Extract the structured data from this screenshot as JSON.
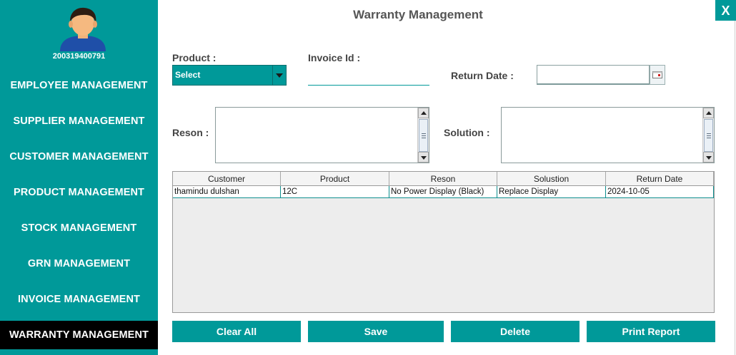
{
  "user": {
    "id": "200319400791"
  },
  "sidebar": {
    "items": [
      {
        "label": "EMPLOYEE MANAGEMENT"
      },
      {
        "label": "SUPPLIER MANAGEMENT"
      },
      {
        "label": "CUSTOMER MANAGEMENT"
      },
      {
        "label": "PRODUCT MANAGEMENT"
      },
      {
        "label": "STOCK MANAGEMENT"
      },
      {
        "label": "GRN MANAGEMENT"
      },
      {
        "label": "INVOICE MANAGEMENT"
      },
      {
        "label": "WARRANTY MANAGEMENT"
      }
    ],
    "active_index": 7
  },
  "header": {
    "title": "Warranty Management",
    "close_label": "X"
  },
  "form": {
    "product_label": "Product :",
    "product_value": "Select",
    "invoice_label": "Invoice Id :",
    "invoice_value": "",
    "return_date_label": "Return Date :",
    "return_date_value": "",
    "reason_label": "Reson :",
    "reason_value": "",
    "solution_label": "Solution :",
    "solution_value": ""
  },
  "table": {
    "columns": [
      "Customer",
      "Product",
      "Reson",
      "Solustion",
      "Return Date"
    ],
    "rows": [
      [
        "thamindu dulshan",
        "12C",
        "No Power Display (Black)",
        "Replace Display",
        "2024-10-05"
      ]
    ]
  },
  "buttons": {
    "clear": "Clear All",
    "save": "Save",
    "delete": "Delete",
    "print": "Print Report"
  },
  "colors": {
    "accent": "#009999",
    "active_nav": "#000000"
  }
}
